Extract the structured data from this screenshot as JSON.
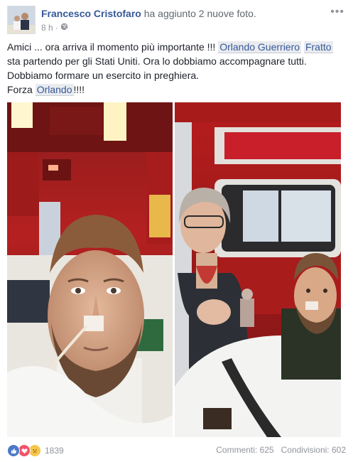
{
  "post": {
    "author": "Francesco Cristofaro",
    "action_prefix": "ha aggiunto",
    "action_count": "2",
    "action_suffix": "nuove foto.",
    "time": "8 h",
    "dot": "·",
    "privacy_icon": "globe-icon",
    "more_icon": "more-options-icon"
  },
  "text": {
    "line1_a": "Amici ... ora arriva il momento più importante !!! ",
    "tag1": "Orlando Guerriero",
    "line1_b": " ",
    "tag2": "Fratto",
    "line2": "sta partendo per gli Stati Uniti. Ora lo dobbiamo accompagnare tutti.",
    "line3": "Dobbiamo formare un esercito in preghiera.",
    "line4_a": "Forza ",
    "tag3": "Orlando",
    "line4_b": "!!!!"
  },
  "photos": [
    {
      "icon": "photo-ambulance-selfie"
    },
    {
      "icon": "photo-ambulance-with-mother"
    }
  ],
  "footer": {
    "reaction_icons": [
      "like-icon",
      "love-icon",
      "sad-icon"
    ],
    "reaction_count": "1839",
    "comments": "Commenti: 625",
    "shares": "Condivisioni: 602"
  },
  "colors": {
    "link": "#365899",
    "meta": "#90949c",
    "text": "#1d2129",
    "tag_bg": "#e9ebee"
  }
}
